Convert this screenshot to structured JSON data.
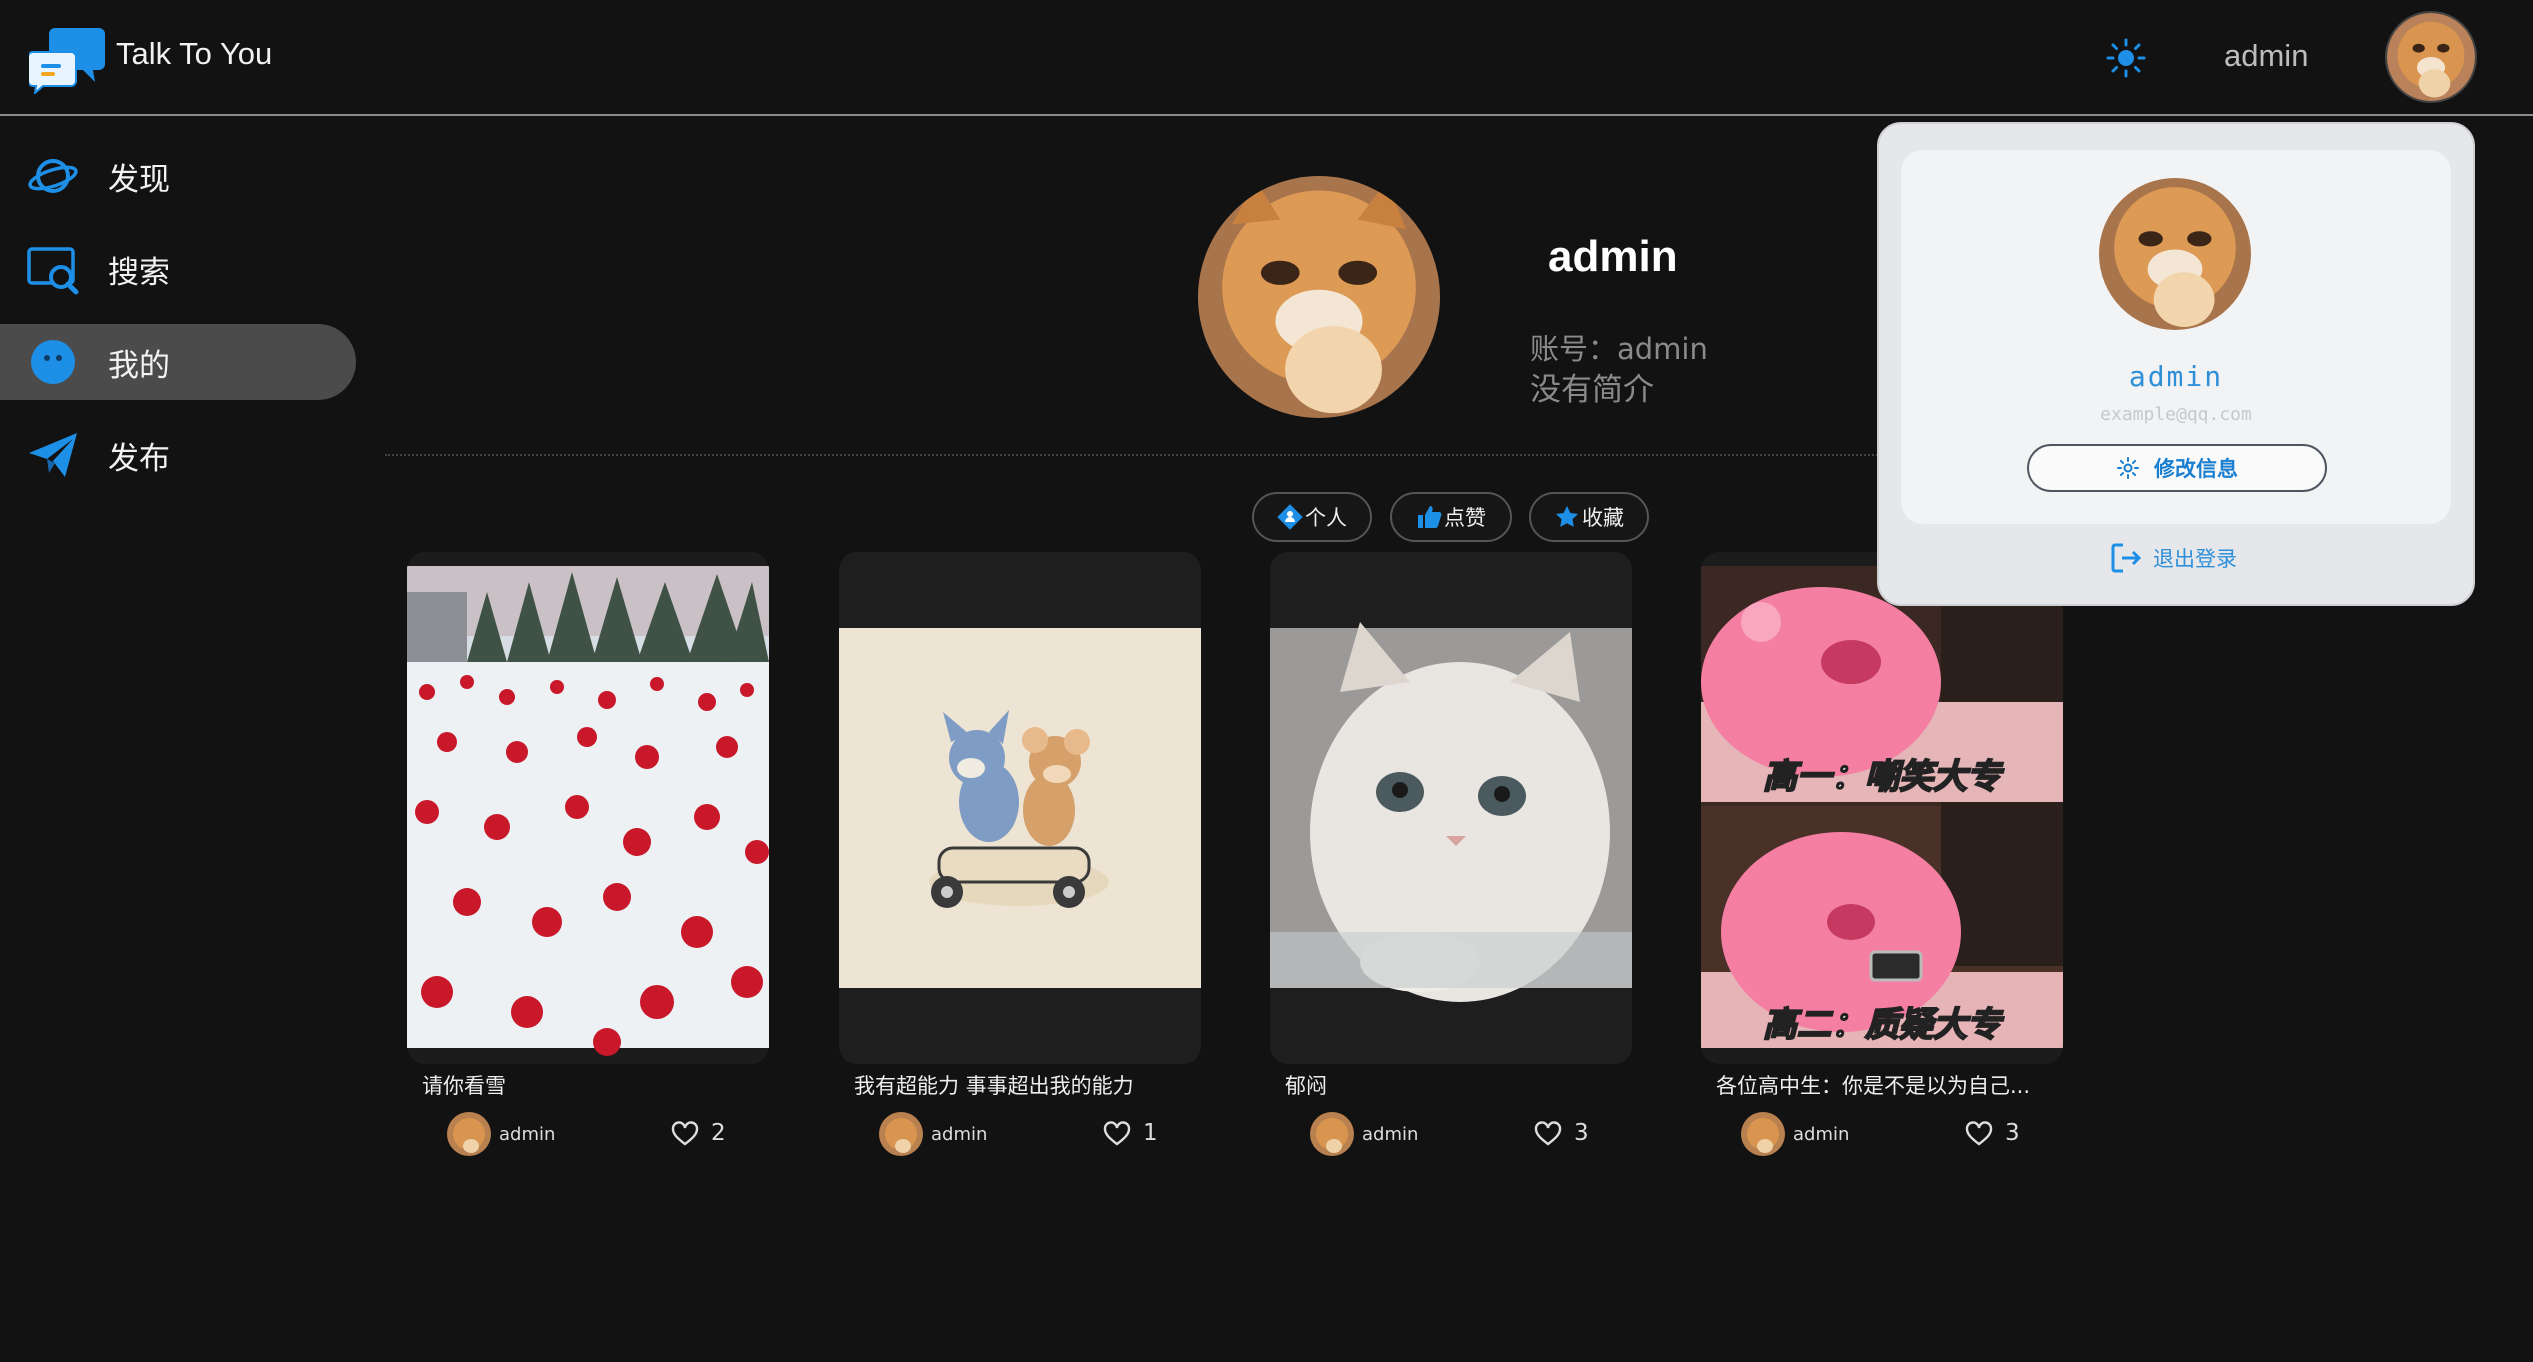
{
  "app": {
    "title": "Talk To You"
  },
  "header": {
    "username": "admin",
    "theme_icon": "sun-icon"
  },
  "sidebar": {
    "items": [
      {
        "label": "发现",
        "icon": "planet-icon"
      },
      {
        "label": "搜索",
        "icon": "search-icon"
      },
      {
        "label": "我的",
        "icon": "face-icon",
        "active": true
      },
      {
        "label": "发布",
        "icon": "paper-plane-icon"
      }
    ]
  },
  "profile": {
    "name": "admin",
    "account": "账号：admin",
    "bio": "没有简介"
  },
  "tabs": [
    {
      "label": "个人",
      "icon": "user-icon"
    },
    {
      "label": "点赞",
      "icon": "thumbs-up-icon"
    },
    {
      "label": "收藏",
      "icon": "star-icon"
    }
  ],
  "posts": [
    {
      "title": "请你看雪",
      "author": "admin",
      "likes": "2",
      "image": "snowy roses"
    },
    {
      "title": "我有超能力 事事超出我的能力",
      "author": "admin",
      "likes": "1",
      "image": "cartoon cat and mouse on scooter"
    },
    {
      "title": "郁闷",
      "author": "admin",
      "likes": "3",
      "image": "sad white kitten"
    },
    {
      "title": "各位高中生：你是不是以为自己...",
      "author": "admin",
      "likes": "3",
      "image": "pink beaver meme",
      "caption_top": "高一：嘲笑大专",
      "caption_bottom": "高二：质疑大专"
    }
  ],
  "user_menu": {
    "name": "admin",
    "email": "example@qq.com",
    "edit_label": "修改信息",
    "logout_label": "退出登录"
  },
  "colors": {
    "accent": "#1e90e0",
    "background": "#121212",
    "menu_bg": "#e6e7ea"
  }
}
